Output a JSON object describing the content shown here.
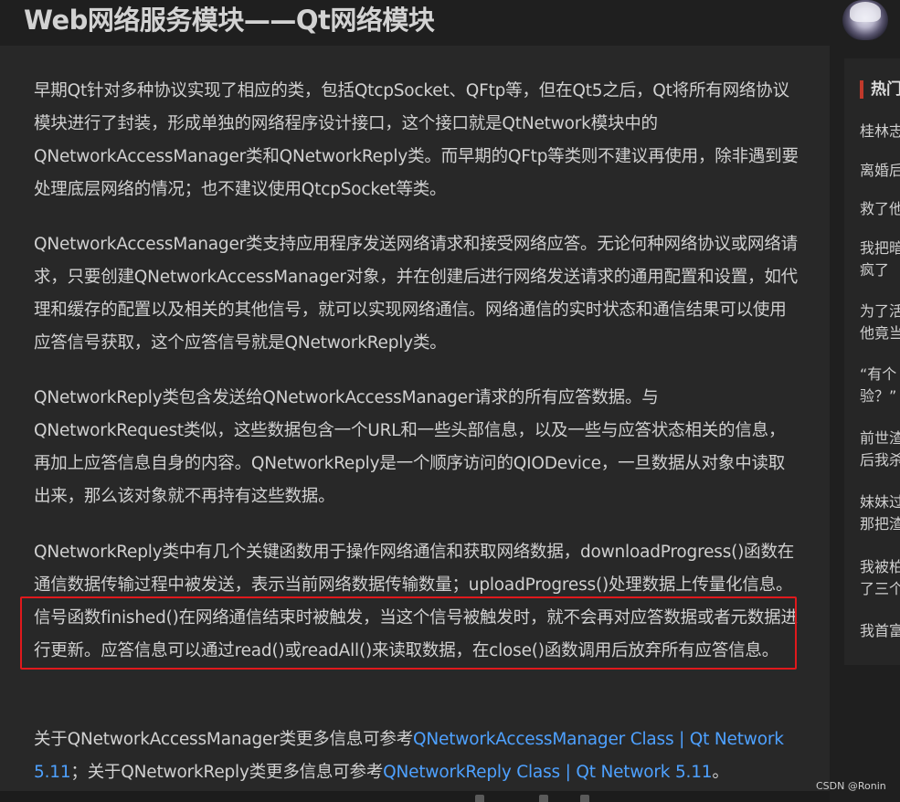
{
  "header": {
    "title": "Web网络服务模块——Qt网络模块",
    "avatar_icon": "user-avatar-icon"
  },
  "article": {
    "paragraphs": [
      "早期Qt针对多种协议实现了相应的类，包括QtcpSocket、QFtp等，但在Qt5之后，Qt将所有网络协议模块进行了封装，形成单独的网络程序设计接口，这个接口就是QtNetwork模块中的QNetworkAccessManager类和QNetworkReply类。而早期的QFtp等类则不建议再使用，除非遇到要处理底层网络的情况；也不建议使用QtcpSocket等类。",
      "QNetworkAccessManager类支持应用程序发送网络请求和接受网络应答。无论何种网络协议或网络请求，只要创建QNetworkAccessManager对象，并在创建后进行网络发送请求的通用配置和设置，如代理和缓存的配置以及相关的其他信号，就可以实现网络通信。网络通信的实时状态和通信结果可以使用应答信号获取，这个应答信号就是QNetworkReply类。",
      "QNetworkReply类包含发送给QNetworkAccessManager请求的所有应答数据。与QNetworkRequest类似，这些数据包含一个URL和一些头部信息，以及一些与应答状态相关的信息，再加上应答信息自身的内容。QNetworkReply是一个顺序访问的QIODevice，一旦数据从对象中读取出来，那么该对象就不再持有这些数据。",
      "QNetworkReply类中有几个关键函数用于操作网络通信和获取网络数据，downloadProgress()函数在通信数据传输过程中被发送，表示当前网络数据传输数量；uploadProgress()处理数据上传量化信息。信号函数finished()在网络通信结束时被触发，当这个信号被触发时，就不会再对应答数据或者元数据进行更新。应答信息可以通过read()或readAll()来读取数据，在close()函数调用后放弃所有应答信息。"
    ],
    "refs": {
      "prefix1": "关于QNetworkAccessManager类更多信息可参考",
      "link1": "QNetworkAccessManager Class | Qt Network 5.11",
      "middle": "；关于QNetworkReply类更多信息可参考",
      "link2": "QNetworkReply Class | Qt Network 5.11",
      "suffix": "。"
    },
    "highlight_color": "#e0191c",
    "link_color": "#4ea1ff"
  },
  "sidebar": {
    "heading": "热门",
    "items": [
      "桂林志",
      "离婚后",
      "救了他",
      "我把暗疯了",
      "为了活他竟当",
      "“有个验？”",
      "前世渣后我杀",
      "妹妹过那把渣",
      "我被柏了三个",
      "我首富"
    ]
  },
  "watermark": "CSDN @Ronin"
}
